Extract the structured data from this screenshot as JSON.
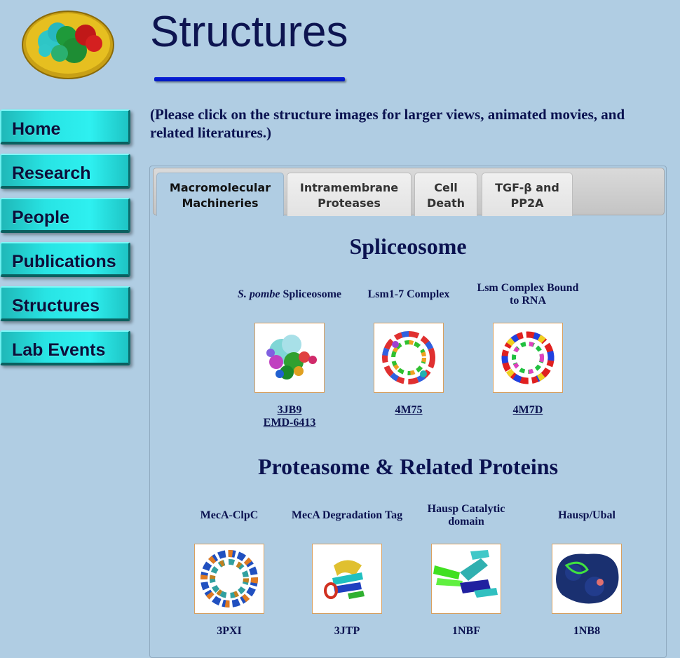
{
  "header": {
    "title": "Structures"
  },
  "nav": [
    {
      "label": "Home"
    },
    {
      "label": "Research"
    },
    {
      "label": "People"
    },
    {
      "label": "Publications"
    },
    {
      "label": "Structures"
    },
    {
      "label": "Lab Events"
    }
  ],
  "instruction": "(Please click on the structure images for larger views, animated movies, and related literatures.)",
  "tabs": [
    {
      "label_line1": "Macromolecular",
      "label_line2": "Machineries",
      "active": true
    },
    {
      "label_line1": "Intramembrane",
      "label_line2": "Proteases",
      "active": false
    },
    {
      "label_line1": "Cell",
      "label_line2": "Death",
      "active": false
    },
    {
      "label_line1": "TGF-β and",
      "label_line2": "PP2A",
      "active": false
    }
  ],
  "sections": [
    {
      "title": "Spliceosome",
      "items": [
        {
          "label_italic": "S. pombe",
          "label": " Spliceosome",
          "links": [
            "3JB9",
            "EMD-6413"
          ],
          "icon": "spliceosome-structure-image"
        },
        {
          "label_italic": "",
          "label": "Lsm1-7 Complex",
          "links": [
            "4M75"
          ],
          "icon": "lsm-complex-structure-image"
        },
        {
          "label_italic": "",
          "label": "Lsm Complex Bound to RNA",
          "links": [
            "4M7D"
          ],
          "icon": "lsm-rna-structure-image"
        }
      ]
    },
    {
      "title": "Proteasome & Related Proteins",
      "items": [
        {
          "label_italic": "",
          "label": "MecA-ClpC",
          "links": [
            "3PXI"
          ],
          "icon": "meca-clpc-structure-image"
        },
        {
          "label_italic": "",
          "label": "MecA Degradation Tag",
          "links": [
            "3JTP"
          ],
          "icon": "meca-tag-structure-image"
        },
        {
          "label_italic": "",
          "label": "Hausp Catalytic domain",
          "links": [
            "1NBF"
          ],
          "icon": "hausp-catalytic-structure-image"
        },
        {
          "label_italic": "",
          "label": "Hausp/Ubal",
          "links": [
            "1NB8"
          ],
          "icon": "hausp-ubal-structure-image"
        }
      ]
    }
  ],
  "colors": {
    "background": "#b0cde3",
    "nav_button": "#28e4e4",
    "title": "#0d1450",
    "underline": "#0b20d8"
  }
}
